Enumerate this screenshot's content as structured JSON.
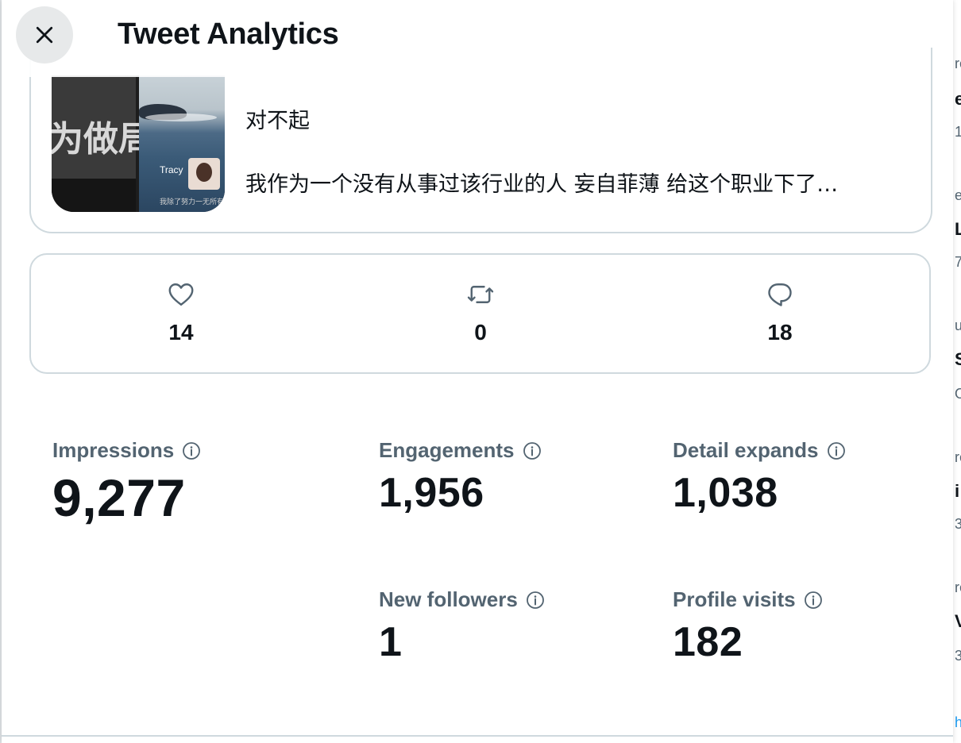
{
  "header": {
    "title": "Tweet Analytics",
    "close_icon": "close-icon"
  },
  "tweet": {
    "media_left_text": "为做局",
    "media_right_caption": "Tracy",
    "media_right_subtitle": "我除了努力一无所有",
    "line1": "对不起",
    "line2": "我作为一个没有从事过该行业的人 妄自菲薄 给这个职业下了…"
  },
  "engagement_counts": {
    "likes": {
      "icon": "heart-icon",
      "value": "14"
    },
    "retweets": {
      "icon": "retweet-icon",
      "value": "0"
    },
    "replies": {
      "icon": "reply-icon",
      "value": "18"
    }
  },
  "stats": {
    "impressions": {
      "label": "Impressions",
      "value": "9,277"
    },
    "engagements": {
      "label": "Engagements",
      "value": "1,956"
    },
    "detail_expands": {
      "label": "Detail expands",
      "value": "1,038"
    },
    "new_followers": {
      "label": "New followers",
      "value": "1"
    },
    "profile_visits": {
      "label": "Profile visits",
      "value": "182"
    }
  },
  "colors": {
    "text_primary": "#0f1419",
    "text_secondary": "#536471",
    "border": "#cfd9de",
    "close_bg": "#e7e9ea"
  }
}
